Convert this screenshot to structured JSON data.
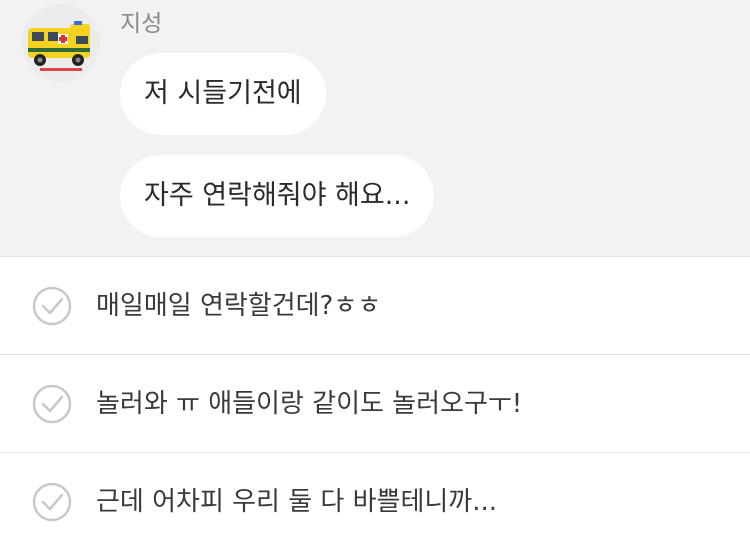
{
  "chat": {
    "sender_name": "지성",
    "messages": [
      "저 시들기전에",
      "자주 연락해줘야 해요..."
    ]
  },
  "reply_options": [
    "매일매일 연락할건데?ㅎㅎ",
    "놀러와 ㅠ 애들이랑 같이도 놀러오구ㅜ!",
    "근데 어차피 우리 둘 다 바쁠테니까..."
  ],
  "colors": {
    "chat_background": "#f2f2f2",
    "bubble": "#ffffff",
    "divider": "#e2e2e2",
    "check_icon": "#c8c8c8",
    "avatar_vehicle": "#f4d21f"
  },
  "icons": {
    "avatar": "ambulance-icon",
    "option": "check-circle-icon"
  }
}
